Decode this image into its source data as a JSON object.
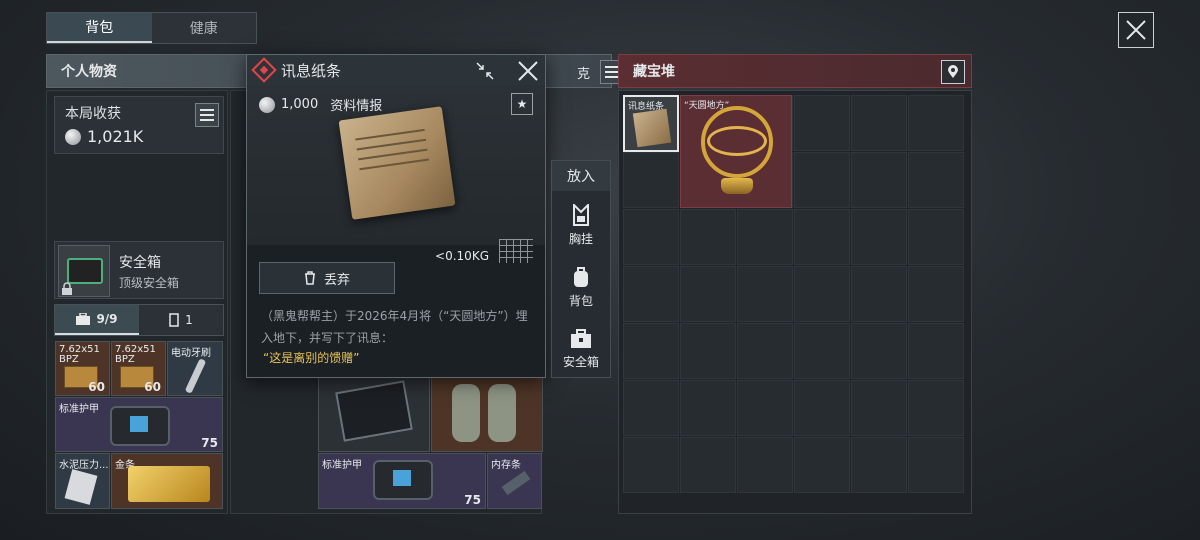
{
  "top_tabs": {
    "backpack": "背包",
    "health": "健康"
  },
  "personal": {
    "title": "个人物资",
    "header_suffix": "克",
    "loot_label": "本局收获",
    "loot_value": "1,021K",
    "safe": {
      "title": "安全箱",
      "subtitle": "顶级安全箱"
    },
    "inv_tab_a": "9/9",
    "inv_tab_b": "1",
    "items": {
      "ammo1": {
        "label": "7.62x51",
        "label2": "BPZ",
        "count": "60"
      },
      "ammo2": {
        "label": "7.62x51",
        "label2": "BPZ",
        "count": "60"
      },
      "brush": {
        "label": "电动牙刷"
      },
      "armor": {
        "label": "标准护甲",
        "count": "75"
      },
      "cement": {
        "label": "水泥压力..."
      },
      "gold": {
        "label": "金条"
      }
    }
  },
  "middle": {
    "armor": {
      "label": "标准护甲",
      "count": "75"
    },
    "memory": {
      "label": "内存条"
    }
  },
  "popup": {
    "title": "讯息纸条",
    "price": "1,000",
    "category": "资料情报",
    "weight": "<0.10KG",
    "discard": "丢弃",
    "desc": "（黑鬼帮帮主）于2026年4月将（“天圆地方”）埋入地下，并写下了讯息：",
    "quote": "“这是离别的馈赠”"
  },
  "put_menu": {
    "title": "放入",
    "chest": "胸挂",
    "backpack": "背包",
    "safebox": "安全箱"
  },
  "treasure": {
    "title": "藏宝堆",
    "note_label": "讯息纸条",
    "globe_label": "“天圆地方”"
  }
}
